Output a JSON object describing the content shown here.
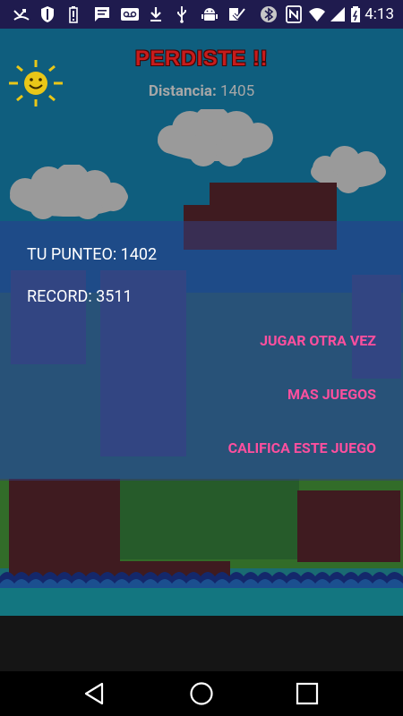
{
  "status_bar": {
    "time": "4:13",
    "icons": [
      "missed-call-icon",
      "shield-icon",
      "battery-alert-icon",
      "message-icon",
      "voicemail-icon",
      "download-icon",
      "usb-icon",
      "android-icon",
      "check-icon",
      "bluetooth-icon",
      "nfc-icon",
      "wifi-icon",
      "signal-icon",
      "battery-icon"
    ]
  },
  "game": {
    "title": "PERDISTE !!",
    "distance_label": "Distancia:",
    "distance_value": "1405"
  },
  "result_panel": {
    "score_text": "TU PUNTEO: 1402",
    "record_text": "RECORD: 3511",
    "menu": [
      {
        "label": "JUGAR OTRA VEZ"
      },
      {
        "label": "MAS JUEGOS"
      },
      {
        "label": "CALIFICA ESTE JUEGO"
      }
    ]
  },
  "nav_bar": {
    "buttons": [
      "back-icon",
      "home-icon",
      "recents-icon"
    ]
  },
  "colors": {
    "menu_text": "#ff4f9e",
    "title": "#c71c1c",
    "sky": "#0f5e7e",
    "status_bar": "#1f1b4e"
  }
}
